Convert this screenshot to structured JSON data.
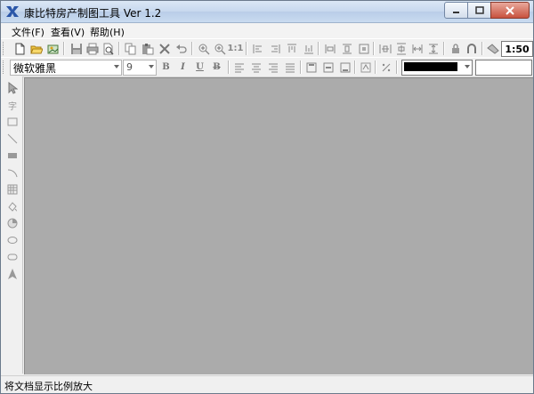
{
  "window": {
    "title": "康比特房产制图工具 Ver 1.2"
  },
  "menu": {
    "items": [
      {
        "label": "文件(F)"
      },
      {
        "label": "查看(V)"
      },
      {
        "label": "帮助(H)"
      }
    ]
  },
  "toolbar": {
    "fit_label": "1:1",
    "zoom_value": "1:50"
  },
  "format_toolbar": {
    "font_family": "微软雅黑",
    "font_size": "9",
    "bold": "B",
    "italic": "I",
    "underline": "U",
    "strike": "B",
    "color_value": "#000000"
  },
  "palette": {
    "text_tool": "字"
  },
  "status": {
    "text": "将文档显示比例放大"
  },
  "colors": {
    "canvas": "#ababab",
    "titlebar": "#c7d8ee"
  }
}
